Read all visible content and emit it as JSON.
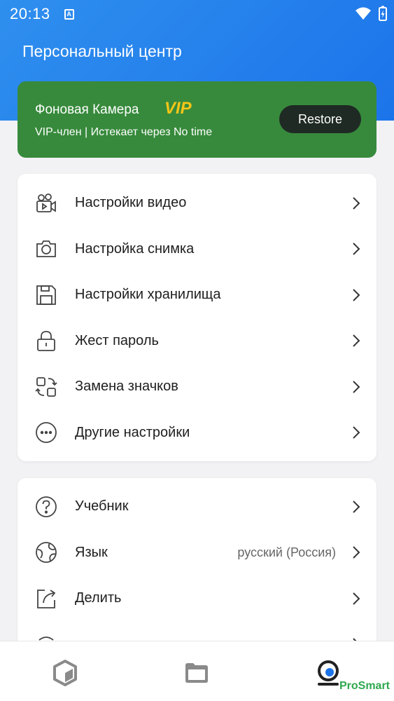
{
  "status_bar": {
    "time": "20:13",
    "notification_badge": "A"
  },
  "header": {
    "title": "Персональный центр"
  },
  "vip_card": {
    "app_name": "Фоновая Камера",
    "badge": "VIP",
    "subtitle": "VIP-член | Истекает через No time",
    "restore_label": "Restore",
    "colors": {
      "background": "#378a3c",
      "badge": "#f5c518"
    }
  },
  "settings_group": {
    "items": [
      {
        "label": "Настройки видео",
        "icon": "video-camera-icon"
      },
      {
        "label": "Настройка снимка",
        "icon": "camera-icon"
      },
      {
        "label": "Настройки хранилища",
        "icon": "storage-icon"
      },
      {
        "label": "Жест пароль",
        "icon": "lock-icon"
      },
      {
        "label": "Замена значков",
        "icon": "swap-icon"
      },
      {
        "label": "Другие настройки",
        "icon": "more-icon"
      }
    ]
  },
  "general_group": {
    "items": [
      {
        "label": "Учебник",
        "icon": "help-icon",
        "value": ""
      },
      {
        "label": "Язык",
        "icon": "globe-icon",
        "value": "русский (Россия)"
      },
      {
        "label": "Делить",
        "icon": "share-icon",
        "value": ""
      }
    ]
  },
  "bottom_nav": {
    "items": [
      {
        "icon": "cube-icon",
        "active": false
      },
      {
        "icon": "folder-icon",
        "active": false
      },
      {
        "icon": "profile-icon",
        "active": true
      }
    ]
  },
  "watermark": "ProSmart",
  "colors": {
    "accent": "#1c74ea"
  }
}
